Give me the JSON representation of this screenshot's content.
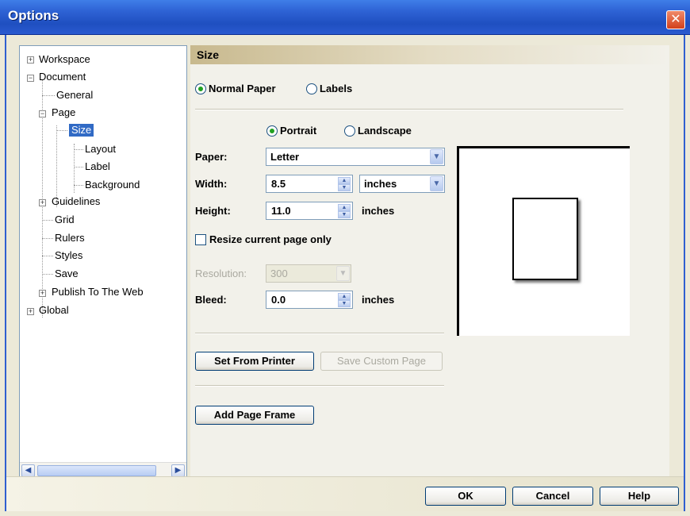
{
  "window": {
    "title": "Options"
  },
  "tree": {
    "items": [
      {
        "label": "Workspace"
      },
      {
        "label": "Document"
      },
      {
        "label": "General"
      },
      {
        "label": "Page"
      },
      {
        "label": "Size"
      },
      {
        "label": "Layout"
      },
      {
        "label": "Label"
      },
      {
        "label": "Background"
      },
      {
        "label": "Guidelines"
      },
      {
        "label": "Grid"
      },
      {
        "label": "Rulers"
      },
      {
        "label": "Styles"
      },
      {
        "label": "Save"
      },
      {
        "label": "Publish To The Web"
      },
      {
        "label": "Global"
      }
    ]
  },
  "panel": {
    "header": "Size",
    "mode": {
      "normal": "Normal Paper",
      "labels": "Labels",
      "selected": "normal"
    },
    "orientation": {
      "portrait": "Portrait",
      "landscape": "Landscape",
      "selected": "portrait"
    },
    "paper": {
      "label": "Paper:",
      "value": "Letter"
    },
    "width": {
      "label": "Width:",
      "value": "8.5",
      "unit": "inches"
    },
    "height": {
      "label": "Height:",
      "value": "11.0",
      "unit": "inches"
    },
    "resize_only": {
      "label": "Resize current page only",
      "checked": false
    },
    "resolution": {
      "label": "Resolution:",
      "value": "300"
    },
    "bleed": {
      "label": "Bleed:",
      "value": "0.0",
      "unit": "inches"
    },
    "buttons": {
      "set_from_printer": "Set From Printer",
      "save_custom_page": "Save Custom Page",
      "add_page_frame": "Add Page Frame"
    }
  },
  "footer": {
    "ok": "OK",
    "cancel": "Cancel",
    "help": "Help"
  }
}
